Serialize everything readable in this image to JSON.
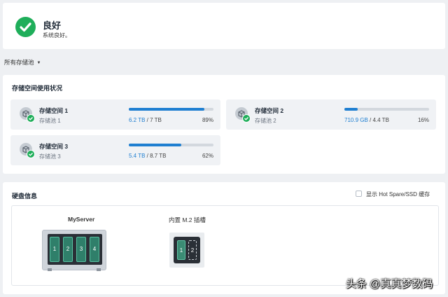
{
  "status": {
    "title": "良好",
    "subtitle": "系统良好。",
    "color": "#1fae5a",
    "icon": "check-icon"
  },
  "filter": {
    "label": "所有存储池"
  },
  "usage": {
    "title": "存储空间使用状况",
    "volumes": [
      {
        "name": "存储空间 1",
        "pool": "存储池 1",
        "used": "6.2 TB",
        "sep": " / ",
        "total": "7 TB",
        "percent": "89%",
        "fill": 0.89
      },
      {
        "name": "存储空间 2",
        "pool": "存储池 2",
        "used": "710.9 GB",
        "sep": " / ",
        "total": "4.4 TB",
        "percent": "16%",
        "fill": 0.16
      },
      {
        "name": "存储空间 3",
        "pool": "存储池 3",
        "used": "5.4 TB",
        "sep": " / ",
        "total": "8.7 TB",
        "percent": "62%",
        "fill": 0.62
      }
    ]
  },
  "disks": {
    "title": "硬盘信息",
    "hotspare_label": "显示 Hot Spare/SSD 缓存",
    "server_name": "MyServer",
    "bays": [
      "1",
      "2",
      "3",
      "4"
    ],
    "m2_title": "内置 M.2 插槽",
    "m2_slots": [
      "1",
      "2"
    ]
  },
  "watermark": "头条 @真真梦数码",
  "colors": {
    "accent": "#1f7fd1",
    "ok": "#1fae5a",
    "bay": "#2f7f6a"
  }
}
